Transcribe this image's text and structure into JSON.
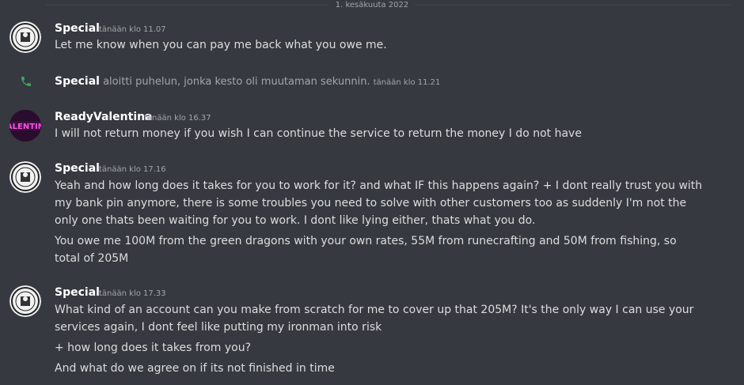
{
  "divider": {
    "date": "1. kesäkuuta 2022"
  },
  "messages": [
    {
      "author": "Special",
      "timestamp": "tänään klo 11.07",
      "lines": [
        "Let me know when you can pay me back what you owe me."
      ]
    },
    {
      "system": true,
      "author": "Special",
      "action": "aloitti puhelun, jonka kesto oli muutaman sekunnin.",
      "timestamp": "tänään klo 11.21",
      "icon": "phone-icon",
      "icon_color": "#3ba55d"
    },
    {
      "author": "ReadyValentina",
      "timestamp": "tänään klo 16.37",
      "avatar_text": "ALENTIN",
      "avatar_color": "#e23ad6",
      "lines": [
        "I will not return money if you wish I can continue the service to return the money I do not have"
      ]
    },
    {
      "author": "Special",
      "timestamp": "tänään klo 17.16",
      "lines": [
        "Yeah and how long does it takes for you to work for it? and what IF this happens again? + I dont really trust you with my bank pin anymore, there is some troubles you need to solve with other customers too as suddenly I'm not the only one thats been waiting for you to work. I dont like lying either, thats what you do.",
        "You owe me 100M from the green dragons with your own rates, 55M from runecrafting and 50M from fishing, so total of 205M"
      ]
    },
    {
      "author": "Special",
      "timestamp": "tänään klo 17.33",
      "lines": [
        "What kind of an account can you make from scratch for me to cover up that 205M? It's the only way I can use your services again, I dont feel like putting my ironman into risk",
        "+ how long does it takes from you?",
        "And what do we agree on if its not finished in time"
      ]
    }
  ],
  "colors": {
    "background": "#36393f",
    "text": "#dcddde",
    "muted": "#a3a6aa"
  }
}
